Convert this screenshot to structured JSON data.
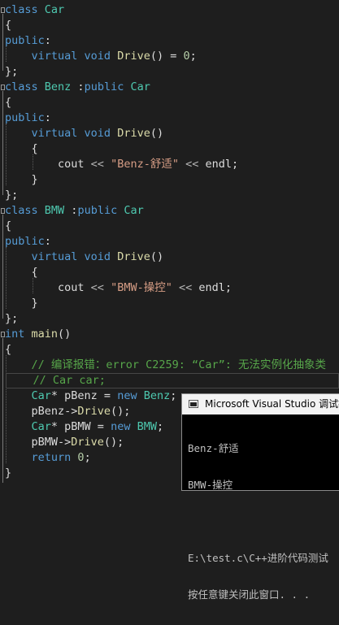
{
  "editor": {
    "lines": [
      [
        {
          "c": "kw",
          "t": "class "
        },
        {
          "c": "ty",
          "t": "Car"
        }
      ],
      [
        {
          "c": "tx",
          "t": "{"
        }
      ],
      [
        {
          "c": "kw",
          "t": "public"
        },
        {
          "c": "tx",
          "t": ":"
        }
      ],
      [
        {
          "c": "tx",
          "t": "    "
        },
        {
          "c": "kw",
          "t": "virtual void "
        },
        {
          "c": "fn",
          "t": "Drive"
        },
        {
          "c": "tx",
          "t": "() = "
        },
        {
          "c": "num",
          "t": "0"
        },
        {
          "c": "tx",
          "t": ";"
        }
      ],
      [
        {
          "c": "tx",
          "t": "};"
        }
      ],
      [
        {
          "c": "kw",
          "t": "class "
        },
        {
          "c": "ty",
          "t": "Benz"
        },
        {
          "c": "tx",
          "t": " :"
        },
        {
          "c": "kw",
          "t": "public "
        },
        {
          "c": "ty",
          "t": "Car"
        }
      ],
      [
        {
          "c": "tx",
          "t": "{"
        }
      ],
      [
        {
          "c": "kw",
          "t": "public"
        },
        {
          "c": "tx",
          "t": ":"
        }
      ],
      [
        {
          "c": "tx",
          "t": "    "
        },
        {
          "c": "kw",
          "t": "virtual void "
        },
        {
          "c": "fn",
          "t": "Drive"
        },
        {
          "c": "tx",
          "t": "()"
        }
      ],
      [
        {
          "c": "tx",
          "t": "    {"
        }
      ],
      [
        {
          "c": "tx",
          "t": "        cout "
        },
        {
          "c": "op",
          "t": "<<"
        },
        {
          "c": "tx",
          "t": " "
        },
        {
          "c": "st",
          "t": "\"Benz-舒适\""
        },
        {
          "c": "tx",
          "t": " "
        },
        {
          "c": "op",
          "t": "<<"
        },
        {
          "c": "tx",
          "t": " endl;"
        }
      ],
      [
        {
          "c": "tx",
          "t": "    }"
        }
      ],
      [
        {
          "c": "tx",
          "t": "};"
        }
      ],
      [
        {
          "c": "kw",
          "t": "class "
        },
        {
          "c": "ty",
          "t": "BMW"
        },
        {
          "c": "tx",
          "t": " :"
        },
        {
          "c": "kw",
          "t": "public "
        },
        {
          "c": "ty",
          "t": "Car"
        }
      ],
      [
        {
          "c": "tx",
          "t": "{"
        }
      ],
      [
        {
          "c": "kw",
          "t": "public"
        },
        {
          "c": "tx",
          "t": ":"
        }
      ],
      [
        {
          "c": "tx",
          "t": "    "
        },
        {
          "c": "kw",
          "t": "virtual void "
        },
        {
          "c": "fn",
          "t": "Drive"
        },
        {
          "c": "tx",
          "t": "()"
        }
      ],
      [
        {
          "c": "tx",
          "t": "    {"
        }
      ],
      [
        {
          "c": "tx",
          "t": "        cout "
        },
        {
          "c": "op",
          "t": "<<"
        },
        {
          "c": "tx",
          "t": " "
        },
        {
          "c": "st",
          "t": "\"BMW-操控\""
        },
        {
          "c": "tx",
          "t": " "
        },
        {
          "c": "op",
          "t": "<<"
        },
        {
          "c": "tx",
          "t": " endl;"
        }
      ],
      [
        {
          "c": "tx",
          "t": "    }"
        }
      ],
      [
        {
          "c": "tx",
          "t": "};"
        }
      ],
      [
        {
          "c": "kw",
          "t": "int "
        },
        {
          "c": "fn",
          "t": "main"
        },
        {
          "c": "tx",
          "t": "()"
        }
      ],
      [
        {
          "c": "tx",
          "t": "{"
        }
      ],
      [
        {
          "c": "tx",
          "t": "    "
        },
        {
          "c": "cm",
          "t": "// 编译报错：error C2259: “Car”: 无法实例化抽象类"
        }
      ],
      [
        {
          "c": "tx",
          "t": "    "
        },
        {
          "c": "cm",
          "t": "// Car car;"
        }
      ],
      [
        {
          "c": "tx",
          "t": "    "
        },
        {
          "c": "ty",
          "t": "Car"
        },
        {
          "c": "tx",
          "t": "* pBenz = "
        },
        {
          "c": "kw",
          "t": "new "
        },
        {
          "c": "ty",
          "t": "Benz"
        },
        {
          "c": "tx",
          "t": ";"
        }
      ],
      [
        {
          "c": "tx",
          "t": "    pBenz->"
        },
        {
          "c": "fn",
          "t": "Drive"
        },
        {
          "c": "tx",
          "t": "();"
        }
      ],
      [
        {
          "c": "tx",
          "t": "    "
        },
        {
          "c": "ty",
          "t": "Car"
        },
        {
          "c": "tx",
          "t": "* pBMW = "
        },
        {
          "c": "kw",
          "t": "new "
        },
        {
          "c": "ty",
          "t": "BMW"
        },
        {
          "c": "tx",
          "t": ";"
        }
      ],
      [
        {
          "c": "tx",
          "t": "    pBMW->"
        },
        {
          "c": "fn",
          "t": "Drive"
        },
        {
          "c": "tx",
          "t": "();"
        }
      ],
      [
        {
          "c": "tx",
          "t": "    "
        },
        {
          "c": "kw",
          "t": "return "
        },
        {
          "c": "num",
          "t": "0"
        },
        {
          "c": "tx",
          "t": ";"
        }
      ],
      [
        {
          "c": "tx",
          "t": "}"
        }
      ]
    ]
  },
  "console": {
    "title": "Microsoft Visual Studio 调试控制台",
    "output_lines": [
      "Benz-舒适",
      "BMW-操控",
      "",
      "E:\\test.c\\C++进阶代码测试",
      "按任意键关闭此窗口. . ."
    ]
  }
}
